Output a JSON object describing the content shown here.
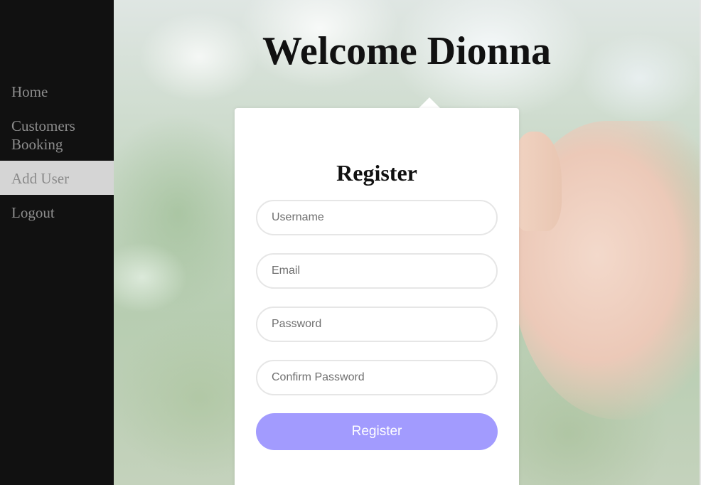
{
  "sidebar": {
    "items": [
      {
        "label": "Home"
      },
      {
        "label": "Customers Booking"
      },
      {
        "label": "Add User",
        "active": true
      },
      {
        "label": "Logout"
      }
    ]
  },
  "header": {
    "welcome": "Welcome Dionna"
  },
  "form": {
    "title": "Register",
    "username_placeholder": "Username",
    "email_placeholder": "Email",
    "password_placeholder": "Password",
    "confirm_password_placeholder": "Confirm Password",
    "submit_label": "Register"
  },
  "colors": {
    "sidebar_bg": "#111111",
    "active_item_bg": "#d5d5d5",
    "button_bg": "#a29bfe"
  }
}
